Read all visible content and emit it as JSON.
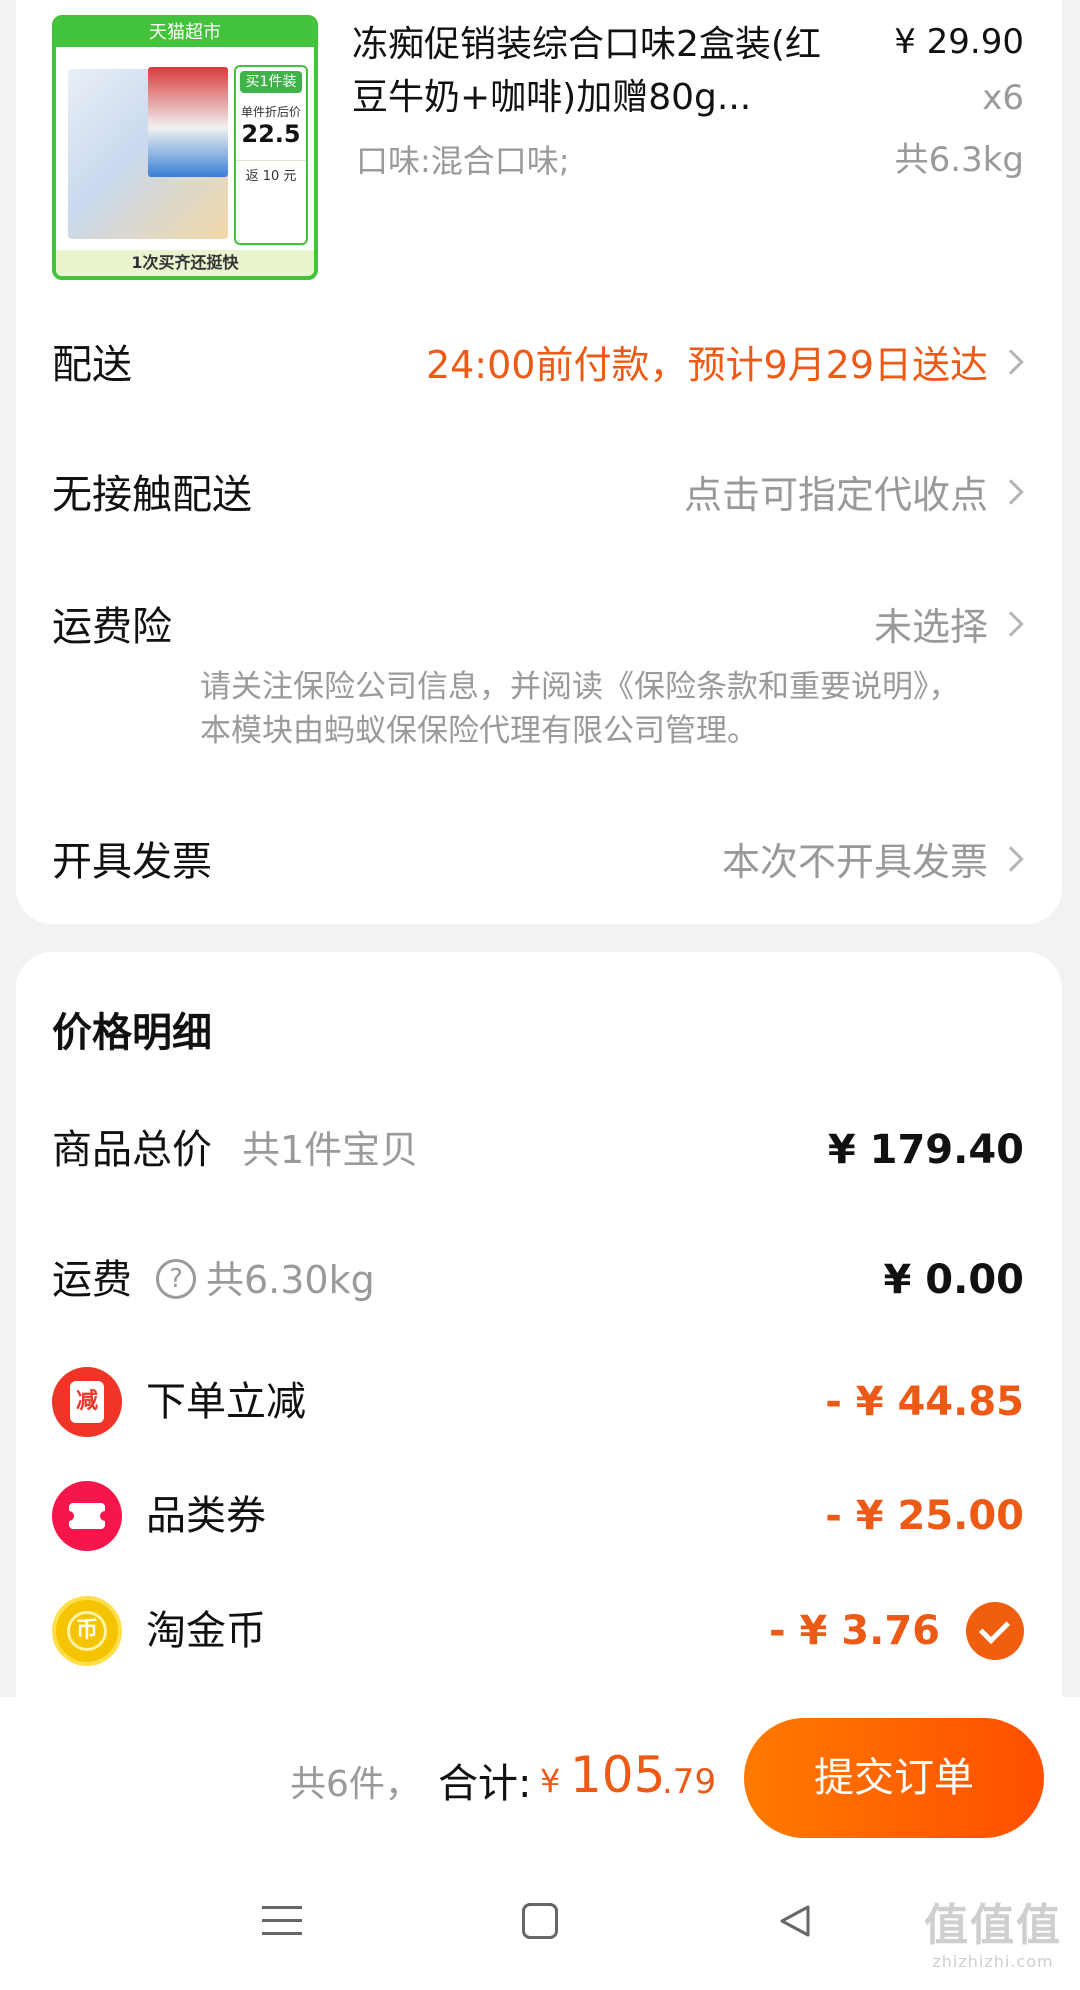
{
  "product": {
    "image_tag": "天猫超市",
    "image_promo": [
      "买1件装",
      "单件折后价",
      "22.5",
      "返 10 元"
    ],
    "image_footer": "1次买齐还挺快",
    "title": "冻痴促销装综合口味2盒装(红豆牛奶+咖啡)加赠80g...",
    "spec": "口味:混合口味;",
    "price": "¥ 29.90",
    "quantity": "x6",
    "weight": "共6.3kg"
  },
  "options": {
    "delivery": {
      "label": "配送",
      "value": "24:00前付款，预计9月29日送达"
    },
    "contactless": {
      "label": "无接触配送",
      "value": "点击可指定代收点"
    },
    "shipping_insurance": {
      "label": "运费险",
      "value": "未选择",
      "note": "请关注保险公司信息，并阅读《保险条款和重要说明》，本模块由蚂蚁保保险代理有限公司管理。"
    },
    "invoice": {
      "label": "开具发票",
      "value": "本次不开具发票"
    }
  },
  "price_details": {
    "title": "价格明细",
    "subtotal": {
      "label": "商品总价",
      "sub": "共1件宝贝",
      "amount": "¥ 179.40"
    },
    "shipping": {
      "label": "运费",
      "sub": "共6.30kg",
      "amount": "¥ 0.00"
    },
    "instant_discount": {
      "label": "下单立减",
      "amount": "- ¥ 44.85",
      "icon_text": "减"
    },
    "category_coupon": {
      "label": "品类券",
      "amount": "- ¥ 25.00"
    },
    "taojinbi": {
      "label": "淘金币",
      "amount": "- ¥ 3.76",
      "icon_text": "币",
      "checked": true
    }
  },
  "bottom_bar": {
    "count": "共6件，",
    "total_label": "合计:",
    "currency": "¥",
    "total_int": "105",
    "total_dec": ".79",
    "submit_label": "提交订单"
  },
  "watermark": {
    "logo": "值值值",
    "url": "zhizhizhi.com"
  },
  "colors": {
    "accent": "#ec5a16",
    "button_start": "#ff7a00",
    "button_end": "#ff4f00",
    "tmall_green": "#43c23b"
  }
}
